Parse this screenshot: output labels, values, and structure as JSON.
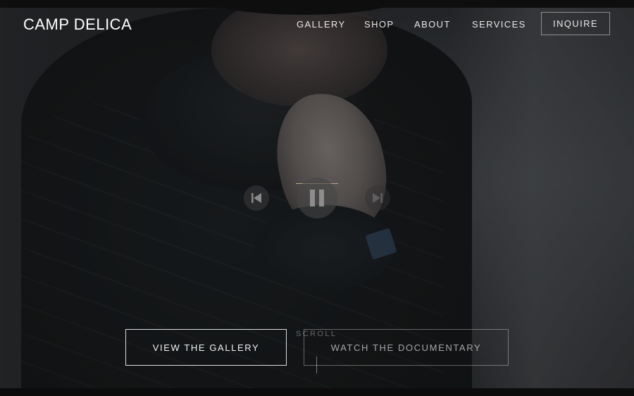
{
  "brand": {
    "logo": "CAMP DELICA"
  },
  "nav": {
    "items": [
      "GALLERY",
      "SHOP",
      "ABOUT",
      "SERVICES"
    ],
    "cta": "INQUIRE"
  },
  "player": {
    "prev_icon": "skip-previous-icon",
    "pause_icon": "pause-icon",
    "next_icon": "skip-next-icon"
  },
  "hero": {
    "buttons": {
      "gallery": "VIEW THE GALLERY",
      "documentary": "WATCH THE DOCUMENTARY"
    },
    "scroll_label": "SCROLL"
  },
  "colors": {
    "accent_line": "#b9a68b",
    "text": "#ffffff"
  }
}
